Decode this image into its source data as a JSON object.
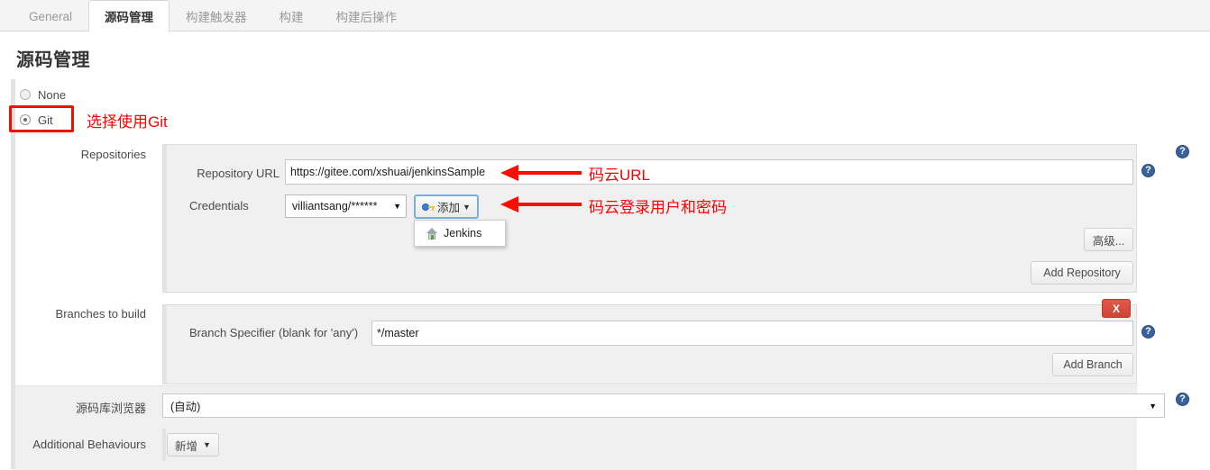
{
  "tabs": [
    {
      "label": "General",
      "active": false
    },
    {
      "label": "源码管理",
      "active": true
    },
    {
      "label": "构建触发器",
      "active": false
    },
    {
      "label": "构建",
      "active": false
    },
    {
      "label": "构建后操作",
      "active": false
    }
  ],
  "page": {
    "title": "源码管理"
  },
  "scm": {
    "options": [
      {
        "label": "None",
        "selected": false
      },
      {
        "label": "Git",
        "selected": true
      }
    ]
  },
  "annotations": {
    "git": "选择使用Git",
    "repo_url": "码云URL",
    "credentials": "码云登录用户和密码"
  },
  "repositories": {
    "label": "Repositories",
    "repo_url_label": "Repository URL",
    "repo_url_value": "https://gitee.com/xshuai/jenkinsSample",
    "credentials_label": "Credentials",
    "credentials_value": "villiantsang/******",
    "add_credential_label": "添加",
    "credential_menu": [
      {
        "label": "Jenkins"
      }
    ],
    "advanced_label": "高级...",
    "add_repository_label": "Add Repository"
  },
  "branches": {
    "label": "Branches to build",
    "specifier_label": "Branch Specifier (blank for 'any')",
    "specifier_value": "*/master",
    "delete_label": "X",
    "add_branch_label": "Add Branch"
  },
  "browser": {
    "label": "源码库浏览器",
    "value": "(自动)"
  },
  "behaviours": {
    "label": "Additional Behaviours",
    "add_label": "新增"
  },
  "icons": {
    "help": "?",
    "caret": "▼"
  },
  "colors": {
    "annotation_red": "#ff0000",
    "highlight_red": "#ee1100",
    "delete_red": "#cf4434",
    "help_blue": "#39619c",
    "focus_blue": "#7aaee0"
  }
}
